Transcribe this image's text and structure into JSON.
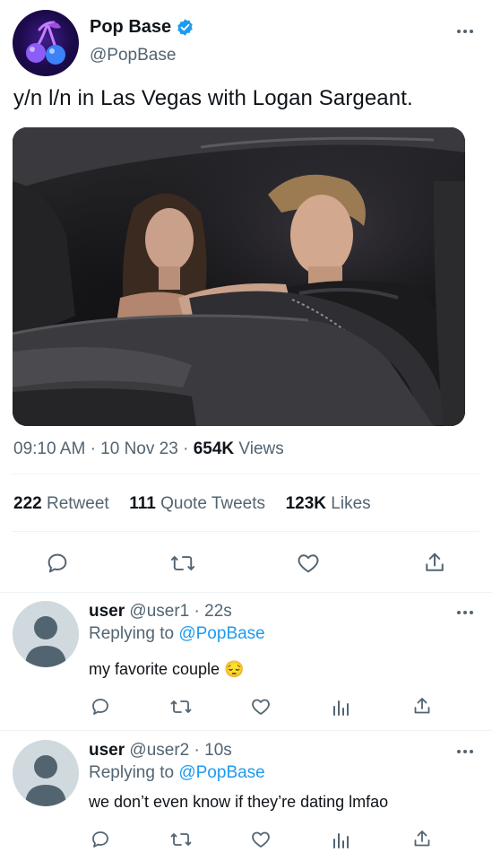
{
  "tweet": {
    "name": "Pop Base",
    "handle": "@PopBase",
    "text": "y/n l/n in Las Vegas with Logan Sargeant.",
    "time": "09:10 AM",
    "date": "10 Nov 23",
    "views_count": "654K",
    "views_label": "Views",
    "retweets_count": "222",
    "retweets_label": "Retweet",
    "quotes_count": "111",
    "quotes_label": "Quote Tweets",
    "likes_count": "123K",
    "likes_label": "Likes"
  },
  "replies": [
    {
      "name": "user",
      "handle": "@user1",
      "time": "22s",
      "replying_label": "Replying to",
      "replying_to": "@PopBase",
      "text": "my favorite couple 😔"
    },
    {
      "name": "user",
      "handle": "@user2",
      "time": "10s",
      "replying_label": "Replying to",
      "replying_to": "@PopBase",
      "text": "we don’t even know if they’re dating lmfao"
    }
  ],
  "colors": {
    "accent": "#1d9bf0",
    "muted": "#536471",
    "text": "#0f1419",
    "divider": "#eff3f4"
  },
  "icons": [
    "verified-badge-icon",
    "more-icon",
    "reply-icon",
    "retweet-icon",
    "like-icon",
    "share-icon",
    "analytics-icon"
  ]
}
